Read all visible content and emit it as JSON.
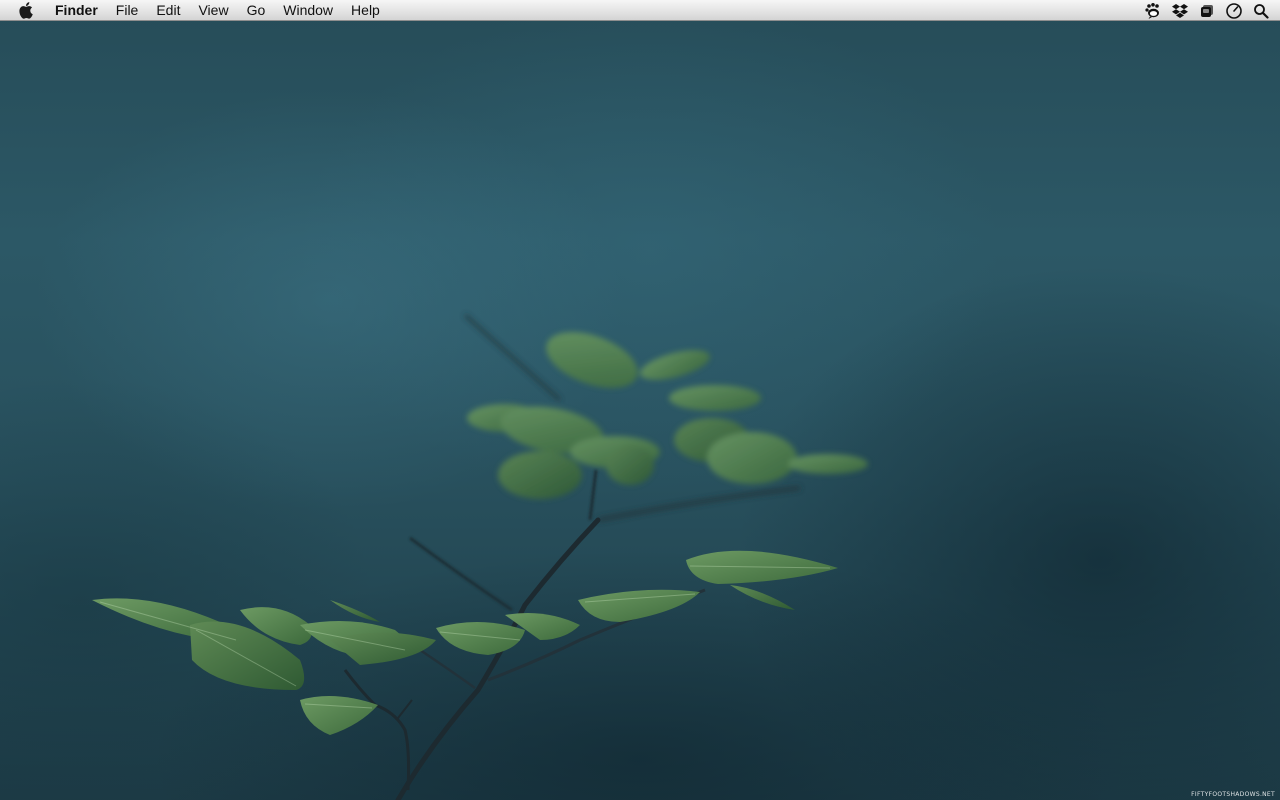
{
  "menubar": {
    "apple_icon": "apple-logo-icon",
    "app_name": "Finder",
    "items": [
      {
        "label": "File"
      },
      {
        "label": "Edit"
      },
      {
        "label": "View"
      },
      {
        "label": "Go"
      },
      {
        "label": "Window"
      },
      {
        "label": "Help"
      }
    ],
    "status_icons": [
      "growl-paw-icon",
      "dropbox-icon",
      "app-stack-icon",
      "clock-icon",
      "spotlight-search-icon"
    ]
  },
  "desktop": {
    "wallpaper_description_colors": {
      "background": "#28505d",
      "leaf": "#4f7a4a",
      "stem": "#1e2e34"
    },
    "watermark": "FIFTYFOOTSHADOWS.NET"
  }
}
